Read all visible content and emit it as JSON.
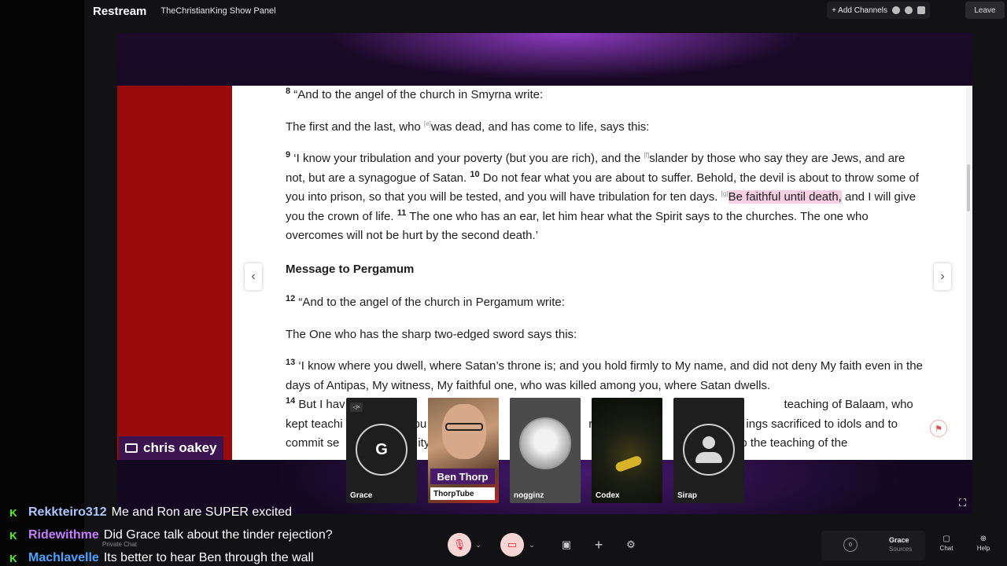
{
  "topbar": {
    "brand": "Restream",
    "show_name": "TheChristianKing Show Panel",
    "add_channels": "+ Add Channels",
    "leave": "Leave"
  },
  "document": {
    "v8_num": "8",
    "v8_text": " “And to the angel of the church in Smyrna write:",
    "line_b": "The first and the last, who ",
    "fn_e": "[e]",
    "line_b2": "was dead, and has come to life, says this:",
    "v9_num": "9",
    "v9_a": " ‘I know your tribulation and your poverty (but you are rich), and the ",
    "fn_f": "[f]",
    "v9_b": "slander by those who say they are Jews, and are not, but are a synagogue of Satan. ",
    "v10_num": "10",
    "v10_text": " Do not fear what you are about to suffer. Behold, the devil is about to throw some of you into prison, so that you will be tested, and you will have tribulation for ten days. ",
    "fn_g": "[g]",
    "highlight": "Be faithful until death,",
    "v10_end": " and I will give you the crown of life. ",
    "v11_num": "11",
    "v11_text": " The one who has an ear, let him hear what the Spirit says to the churches. The one who overcomes will not be hurt by the second death.’",
    "heading": "Message to Pergamum",
    "v12_num": "12",
    "v12_text": " “And to the angel of the church in Pergamum write:",
    "line_sword": "The One who has the sharp two-edged sword says this:",
    "v13_num": "13",
    "v13_text": " ‘I know where you dwell, where Satan’s throne is; and you hold firmly to My name, and did not deny My faith even in the days of Antipas, My witness, My faithful one, who was killed among you, where Satan dwells.",
    "v14_num": "14",
    "v14_a": " But I hav",
    "v14_b": "gs",
    "v14_c": "b",
    "v14_d": "a",
    "v14_e": "e",
    "v14_f": "teaching of Balaam, who",
    "v14_line2a": "kept teachi",
    "v14_line2b": "ou",
    "v14_line2c": "re",
    "v14_line2d": "sra",
    "v14_line2e": "ings sacrificed to idols and to",
    "v14_line3a": "commit se",
    "v14_line3b": "ity",
    "v14_line3c": "o the teaching of the"
  },
  "presenter": {
    "name": "chris oakey"
  },
  "participants": [
    {
      "name": "Grace",
      "initial": "G"
    },
    {
      "name": "Ben Thorp",
      "sub": "ThorpTube"
    },
    {
      "name": "nogginz"
    },
    {
      "name": "Codex"
    },
    {
      "name": "Sirap"
    }
  ],
  "chat": [
    {
      "user": "Rekkteiro312",
      "color": "#a9c6ff",
      "message": "Me and Ron are SUPER excited"
    },
    {
      "user": "Ridewithme",
      "color": "#c77dff",
      "message": "Did Grace talk about the tinder rejection?"
    },
    {
      "user": "Machlavelle",
      "color": "#4aa3ff",
      "message": "Its better to hear Ben through the wall"
    }
  ],
  "chat_badge": "K",
  "private_chat": "Private Chat",
  "controls": {
    "rec_count": "0",
    "grace": "Grace",
    "sources": "Sources",
    "chat": "Chat",
    "help": "Help"
  },
  "icons": [
    "screen-share-icon",
    "mic-muted-icon",
    "camera-off-icon",
    "present-icon",
    "plus-icon",
    "settings-icon",
    "chat-icon",
    "help-icon",
    "fullscreen-icon",
    "pdf-icon"
  ]
}
